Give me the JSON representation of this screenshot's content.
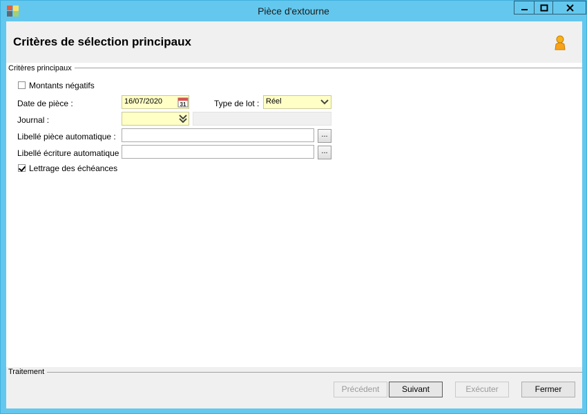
{
  "window": {
    "title": "Pièce d'extourne"
  },
  "header": {
    "title": "Critères de sélection principaux"
  },
  "icons": {
    "app": "app-grid-icon",
    "user": "user-icon",
    "calendar": "calendar-icon",
    "dropdown": "chevron-down-icon",
    "minimize": "minimize-icon",
    "maximize": "maximize-icon",
    "close": "close-icon"
  },
  "main_group": {
    "label": "Critères principaux"
  },
  "form": {
    "montants_negatifs": {
      "label": "Montants négatifs",
      "checked": false
    },
    "date_piece": {
      "label": "Date de pièce :",
      "value": "16/07/2020",
      "calendar_day": "31"
    },
    "type_lot": {
      "label": "Type de lot :",
      "value": "Réel"
    },
    "journal": {
      "label": "Journal :",
      "value": "",
      "description": ""
    },
    "libelle_piece": {
      "label": "Libellé pièce automatique :",
      "value": "",
      "button": "..."
    },
    "libelle_ecriture": {
      "label": "Libellé écriture automatique :",
      "value": "",
      "button": "..."
    },
    "lettrage": {
      "label": "Lettrage des échéances",
      "checked": true
    }
  },
  "footer_group": {
    "label": "Traitement"
  },
  "buttons": {
    "previous": "Précédent",
    "next": "Suivant",
    "execute": "Exécuter",
    "close": "Fermer"
  },
  "colors": {
    "titlebar": "#64c8ee",
    "required_field": "#ffffc6"
  }
}
